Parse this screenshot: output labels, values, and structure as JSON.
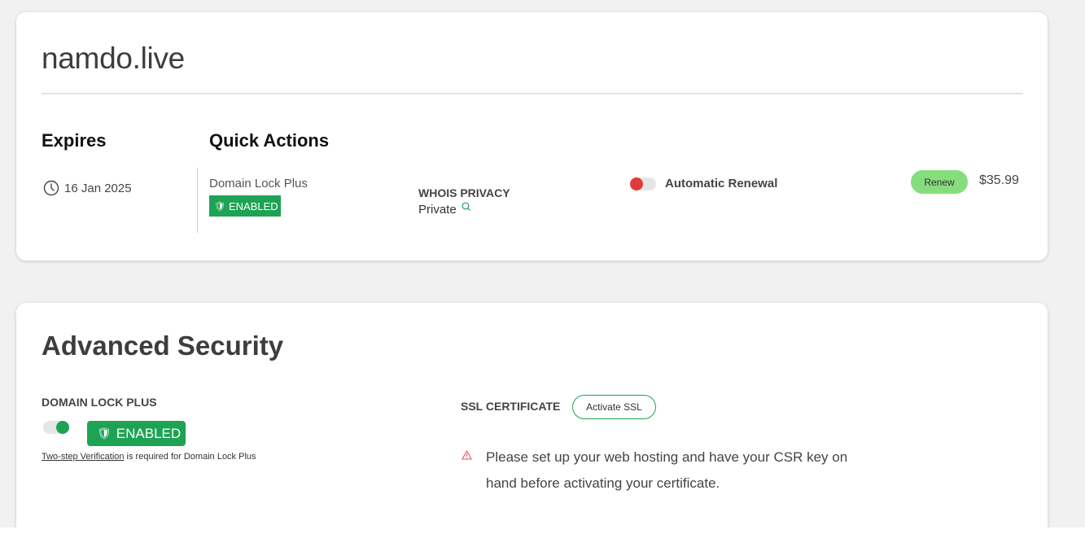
{
  "domain": {
    "name": "namdo.live"
  },
  "overview": {
    "expires_heading": "Expires",
    "expires_date": "16 Jan 2025",
    "quick_actions_heading": "Quick Actions",
    "domain_lock": {
      "label": "Domain Lock Plus",
      "status": "ENABLED"
    },
    "whois": {
      "label": "WHOIS PRIVACY",
      "value": "Private"
    },
    "auto_renew": {
      "label": "Automatic Renewal",
      "enabled": false
    },
    "renew_button": "Renew",
    "price": "$35.99"
  },
  "advanced_security": {
    "title": "Advanced Security",
    "domain_lock_heading": "DOMAIN LOCK PLUS",
    "domain_lock_enabled": true,
    "domain_lock_status": "ENABLED",
    "two_step_link": "Two-step Verification",
    "two_step_note": " is required for Domain Lock Plus",
    "ssl_heading": "SSL CERTIFICATE",
    "ssl_button": "Activate SSL",
    "ssl_warning": "Please set up your web hosting and have your CSR key on hand before activating your certificate."
  },
  "colors": {
    "accent_green": "#1ea354",
    "renew_green": "#86dd7c",
    "toggle_off_red": "#e03b3b",
    "warning_pink": "#e0556f"
  },
  "icons": [
    "clock-icon",
    "shield-icon",
    "magnifier-icon",
    "warning-icon"
  ]
}
